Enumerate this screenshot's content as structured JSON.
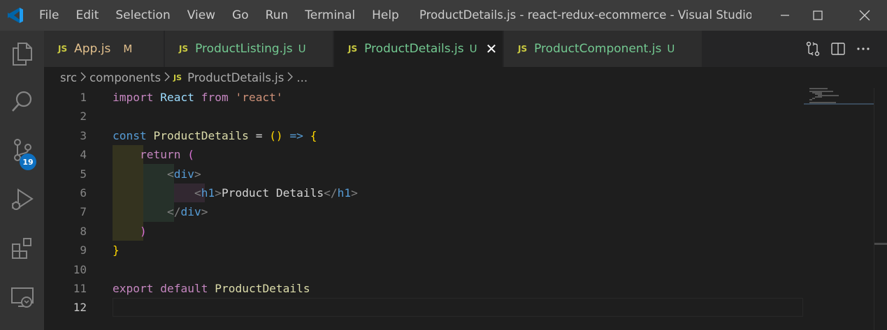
{
  "menu": [
    "File",
    "Edit",
    "Selection",
    "View",
    "Go",
    "Run",
    "Terminal",
    "Help"
  ],
  "window_title": "ProductDetails.js - react-redux-ecommerce - Visual Studio C...",
  "activity": {
    "source_control_badge": "19",
    "icons": [
      "explorer-icon",
      "search-icon",
      "source-control-icon",
      "run-debug-icon",
      "extensions-icon",
      "remote-explorer-icon"
    ]
  },
  "tabs": [
    {
      "icon": "JS",
      "label": "App.js",
      "status": "M",
      "label_color": "#e2c08d",
      "status_color": "#e2c08d"
    },
    {
      "icon": "JS",
      "label": "ProductListing.js",
      "status": "U",
      "label_color": "#73c991",
      "status_color": "#73c991"
    },
    {
      "icon": "JS",
      "label": "ProductDetails.js",
      "status": "U",
      "label_color": "#73c991",
      "status_color": "#73c991",
      "active": true,
      "close": "✕"
    },
    {
      "icon": "JS",
      "label": "ProductComponent.js",
      "status": "U",
      "label_color": "#73c991",
      "status_color": "#73c991"
    }
  ],
  "breadcrumb": {
    "parts": [
      "src",
      "components",
      "ProductDetails.js",
      "..."
    ],
    "file_icon": "JS"
  },
  "editor": {
    "current_line": 12,
    "line_numbers": [
      "1",
      "2",
      "3",
      "4",
      "5",
      "6",
      "7",
      "8",
      "9",
      "10",
      "11",
      "12"
    ],
    "code": {
      "l1_import": "import",
      "l1_react": "React",
      "l1_from": "from",
      "l1_str": "'react'",
      "l3_const": "const",
      "l3_name": "ProductDetails",
      "l3_eq": "=",
      "l3_paren": "()",
      "l3_arrow": "=>",
      "l3_brace": "{",
      "l4_return": "return",
      "l4_paren": "(",
      "l5_lt": "<",
      "l5_div": "div",
      "l5_gt": ">",
      "l6_lt": "<",
      "l6_h1": "h1",
      "l6_gt": ">",
      "l6_text": "Product Details",
      "l6_close_lt": "</",
      "l6_close_h1": "h1",
      "l6_close_gt": ">",
      "l7_lt": "</",
      "l7_div": "div",
      "l7_gt": ">",
      "l8_paren": ")",
      "l9_brace": "}",
      "l11_export": "export",
      "l11_default": "default",
      "l11_name": "ProductDetails"
    }
  },
  "colors": {
    "editor_bg": "#1e1e1e",
    "titlebar_bg": "#3c3c3c",
    "activitybar_bg": "#333333",
    "badge_bg": "#0e70c0",
    "keyword": "#569cd6",
    "control": "#c586c0",
    "string": "#ce9178",
    "function": "#dcdcaa",
    "bracket_gold": "#ffd700",
    "bracket_orchid": "#da70d6"
  }
}
